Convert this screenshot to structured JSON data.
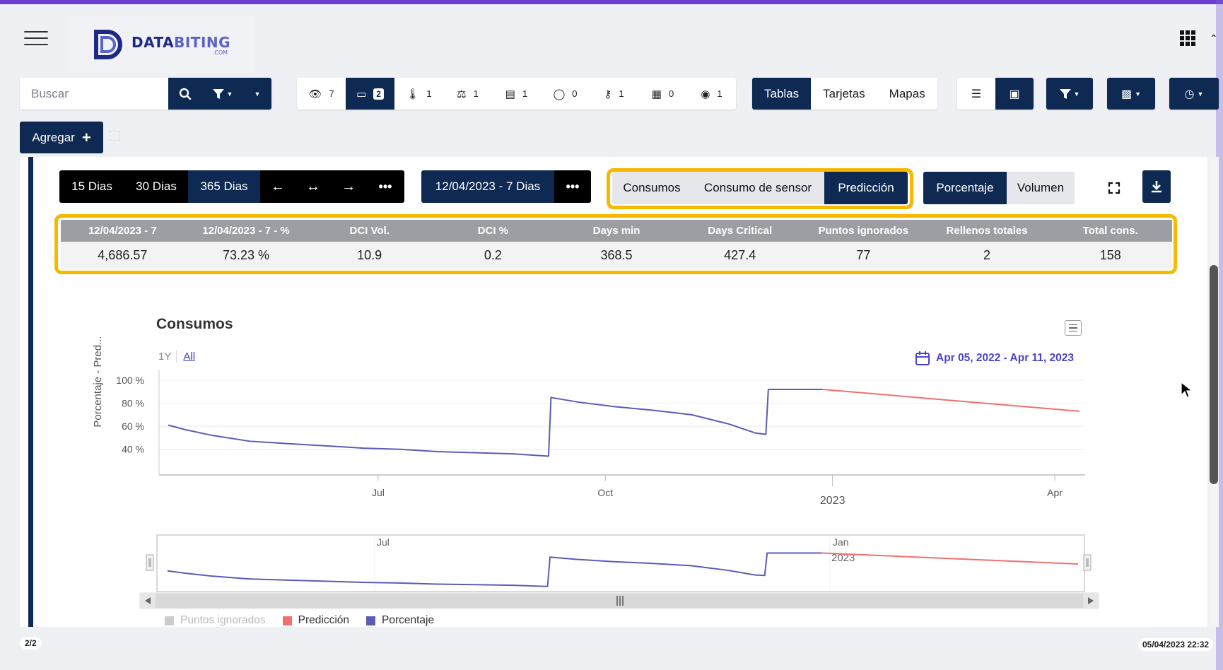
{
  "header": {
    "logo_text_main_a": "DATA",
    "logo_text_main_b": "BITING",
    "logo_text_sub": ".COM"
  },
  "search": {
    "placeholder": "Buscar"
  },
  "counters": [
    {
      "icon": "eye-icon",
      "value": "7"
    },
    {
      "icon": "battery-icon",
      "value": "2",
      "active": true
    },
    {
      "icon": "thermometer-icon",
      "value": "1"
    },
    {
      "icon": "scale-icon",
      "value": "1"
    },
    {
      "icon": "tank-icon",
      "value": "1"
    },
    {
      "icon": "toggle-icon",
      "value": "0"
    },
    {
      "icon": "runner-icon",
      "value": "1"
    },
    {
      "icon": "building-icon",
      "value": "0"
    },
    {
      "icon": "location-icon",
      "value": "1"
    }
  ],
  "views": {
    "tables": "Tablas",
    "cards": "Tarjetas",
    "maps": "Mapas"
  },
  "add_button": "Agregar",
  "period": {
    "d15": "15 Dias",
    "d30": "30 Dias",
    "d365": "365 Dias"
  },
  "date_period": "12/04/2023 - 7 Dias",
  "modes": {
    "consumos": "Consumos",
    "sensor": "Consumo de sensor",
    "prediccion": "Predicción"
  },
  "units": {
    "percent": "Porcentaje",
    "volume": "Volumen"
  },
  "stats": {
    "headers": [
      "12/04/2023 - 7",
      "12/04/2023 - 7 - %",
      "DCI Vol.",
      "DCI %",
      "Days min",
      "Days Critical",
      "Puntos ignorados",
      "Rellenos totales",
      "Total cons."
    ],
    "values": [
      "4,686.57",
      "73.23 %",
      "10.9",
      "0.2",
      "368.5",
      "427.4",
      "77",
      "2",
      "158"
    ]
  },
  "chart": {
    "range_1y": "1Y",
    "range_all": "All",
    "date_range": "Apr 05, 2022 - Apr 11, 2023",
    "navigator_labels": {
      "jul": "Jul",
      "jan": "Jan",
      "year": "2023"
    }
  },
  "chart_data": {
    "type": "line",
    "title": "Consumos",
    "ylabel": "Porcentaje - Pred...",
    "y_ticks": [
      "100 %",
      "80 %",
      "60 %",
      "40 %"
    ],
    "x_ticks": [
      "Jul",
      "Oct",
      "2023",
      "Apr"
    ],
    "ylim": [
      30,
      105
    ],
    "legend": [
      "Puntos ignorados",
      "Predicción",
      "Porcentaje"
    ],
    "colors": {
      "porcentaje": "#5b5cb8",
      "prediccion": "#f07070",
      "ignorados": "#cccccc"
    },
    "series": [
      {
        "name": "Porcentaje",
        "x": [
          "2022-04-07",
          "2022-04-14",
          "2022-04-25",
          "2022-05-10",
          "2022-05-25",
          "2022-06-10",
          "2022-06-25",
          "2022-07-10",
          "2022-07-25",
          "2022-08-10",
          "2022-08-25",
          "2022-09-08",
          "2022-09-09",
          "2022-09-20",
          "2022-10-05",
          "2022-10-20",
          "2022-11-05",
          "2022-11-20",
          "2022-12-01",
          "2022-12-05",
          "2022-12-06",
          "2022-12-28"
        ],
        "y": [
          61,
          57,
          52,
          47,
          45,
          43,
          41,
          40,
          38,
          37,
          36,
          34,
          85,
          81,
          77,
          74,
          70,
          62,
          54,
          53,
          92,
          92
        ]
      },
      {
        "name": "Predicción",
        "x": [
          "2022-12-28",
          "2023-04-11"
        ],
        "y": [
          92,
          73
        ]
      }
    ]
  },
  "footer": {
    "page": "2/2",
    "timestamp": "05/04/2023 22:32"
  }
}
